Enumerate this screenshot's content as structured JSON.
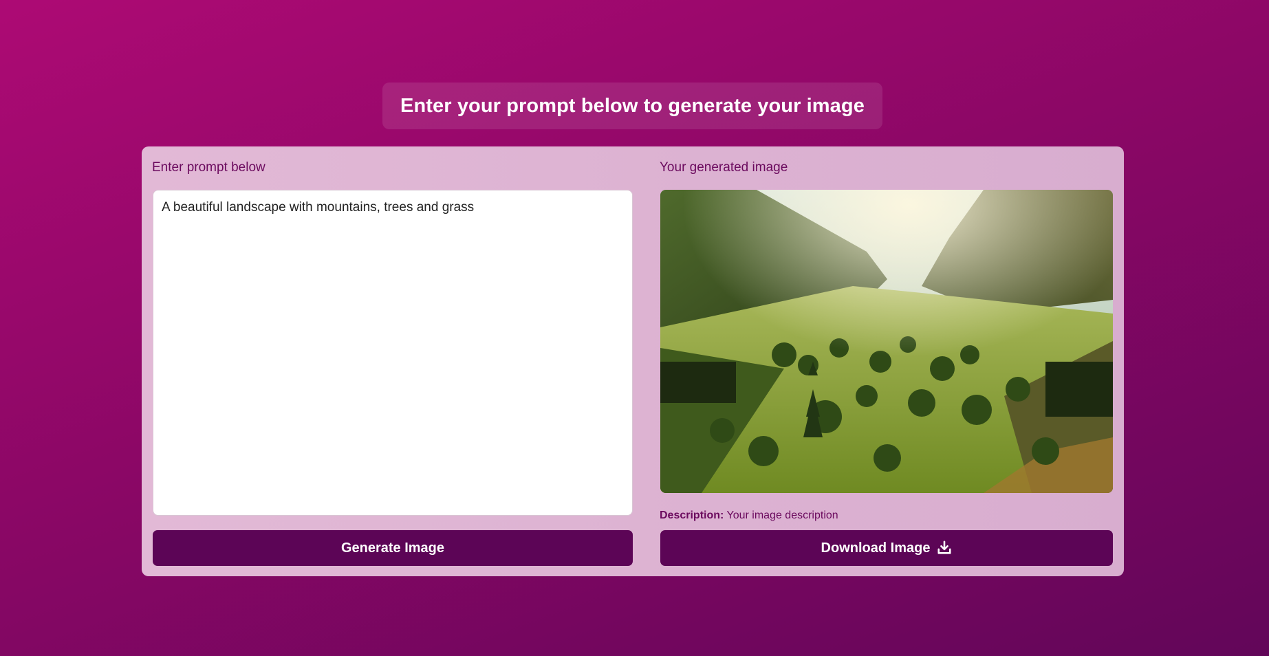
{
  "header": {
    "title": "Enter your prompt below to generate your image"
  },
  "prompt_panel": {
    "label": "Enter prompt below",
    "prompt_value": "A beautiful landscape with mountains, trees and grass",
    "generate_button_label": "Generate Image"
  },
  "result_panel": {
    "label": "Your generated image",
    "description_label": "Description:",
    "description_value": "Your image description",
    "download_button_label": "Download Image",
    "download_icon": "download-icon"
  },
  "colors": {
    "background_start": "#ad0a74",
    "background_end": "#620659",
    "card": "#e2b9d6",
    "button": "#5c0556",
    "label_text": "#6b0a5e"
  }
}
